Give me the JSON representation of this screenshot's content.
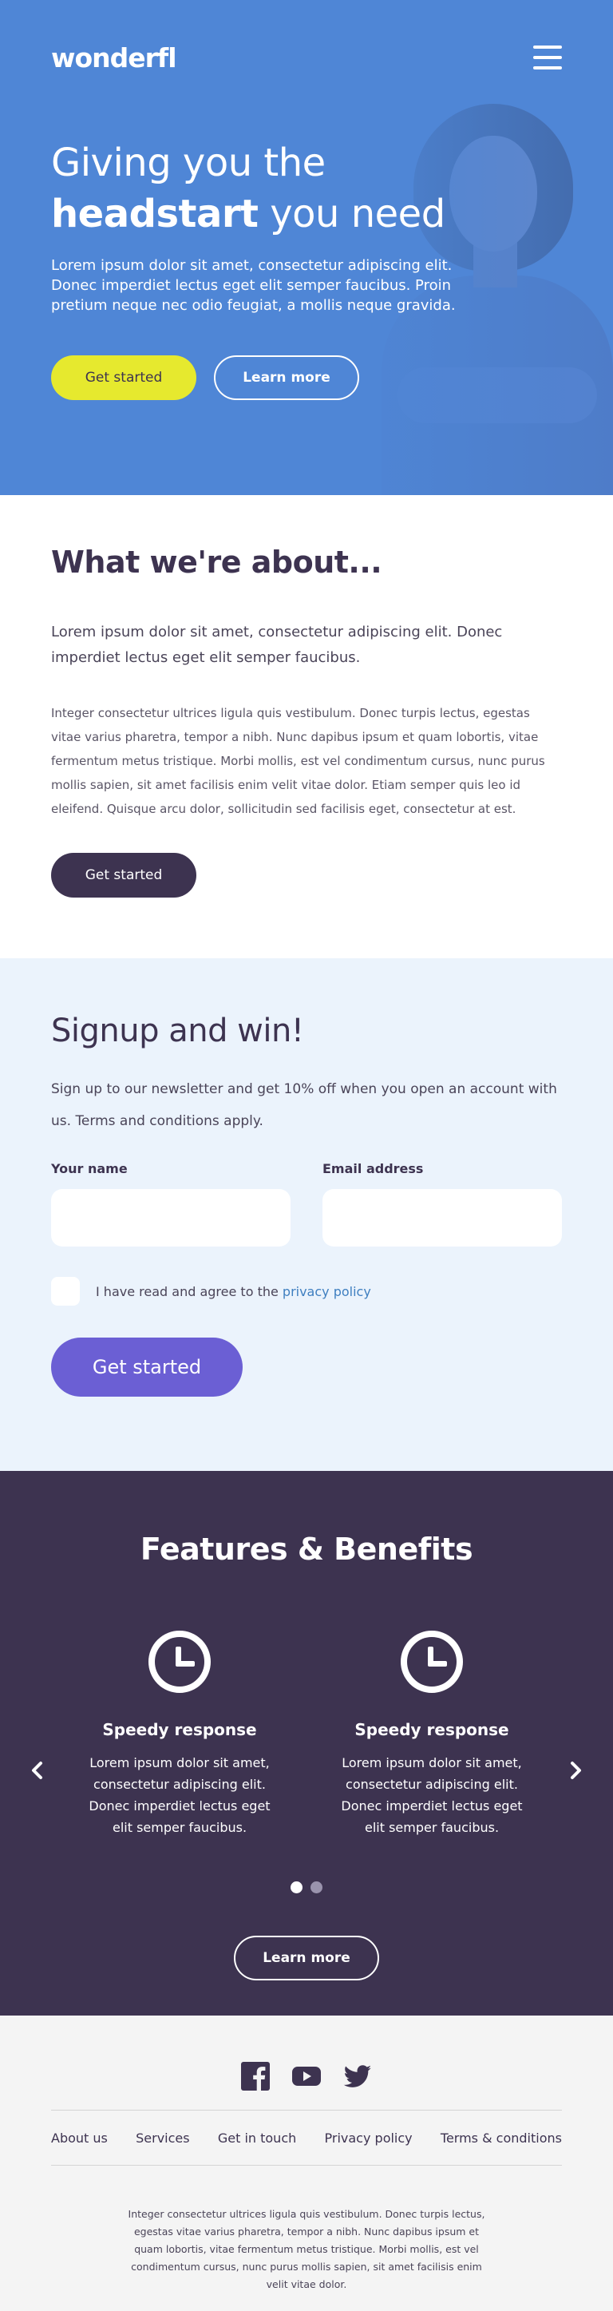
{
  "brand": {
    "logo": "wonderfl"
  },
  "hero": {
    "title_line1": "Giving you the",
    "title_bold": "headstart",
    "title_rest": " you need",
    "lead": "Lorem ipsum dolor sit amet, consectetur adipiscing elit. Donec imperdiet lectus eget elit semper faucibus. Proin pretium neque nec odio feugiat, a mollis neque gravida.",
    "primary_button": "Get started",
    "secondary_button": "Learn more"
  },
  "about": {
    "title": "What we're about...",
    "lead": "Lorem ipsum dolor sit amet, consectetur adipiscing elit. Donec imperdiet lectus eget elit semper faucibus.",
    "body": "Integer consectetur ultrices ligula quis vestibulum. Donec turpis lectus, egestas vitae varius pharetra, tempor a nibh. Nunc dapibus ipsum et quam lobortis, vitae fermentum metus tristique. Morbi mollis, est vel condimentum cursus, nunc purus mollis sapien, sit amet facilisis enim velit vitae dolor. Etiam semper quis leo id eleifend. Quisque arcu dolor, sollicitudin sed facilisis eget, consectetur at est.",
    "button": "Get started"
  },
  "signup": {
    "title": "Signup and win!",
    "text": "Sign up to our newsletter and get 10% off when you open an account with us. Terms and conditions apply.",
    "name_label": "Your name",
    "name_value": "",
    "email_label": "Email address",
    "email_value": "",
    "consent_text": "I have read and agree to the ",
    "consent_link": "privacy policy",
    "button": "Get started"
  },
  "features": {
    "title": "Features & Benefits",
    "items": [
      {
        "name": "Speedy response",
        "desc": "Lorem ipsum dolor sit amet, consectetur adipiscing elit. Donec imperdiet lectus eget elit semper faucibus.",
        "icon": "clock-icon"
      },
      {
        "name": "Speedy response",
        "desc": "Lorem ipsum dolor sit amet, consectetur adipiscing elit. Donec imperdiet lectus eget elit semper faucibus.",
        "icon": "clock-icon"
      }
    ],
    "active_slide": 1,
    "slide_count": 2,
    "button": "Learn more"
  },
  "footer": {
    "socials": [
      "facebook-icon",
      "youtube-icon",
      "twitter-icon"
    ],
    "nav": [
      "About us",
      "Services",
      "Get in touch",
      "Privacy policy",
      "Terms & conditions"
    ],
    "text": "Integer consectetur ultrices ligula quis vestibulum. Donec turpis lectus, egestas vitae varius pharetra, tempor a nibh. Nunc dapibus ipsum et quam lobortis, vitae fermentum metus tristique. Morbi mollis, est vel condimentum cursus, nunc purus mollis sapien, sit amet facilisis enim velit vitae dolor."
  },
  "colors": {
    "hero_bg": "#4f86d6",
    "dark": "#3d3350",
    "accent_yellow": "#e6e92e",
    "accent_purple": "#6b5fd4",
    "signup_bg": "#ebf3fc",
    "link": "#3f7fc0"
  }
}
